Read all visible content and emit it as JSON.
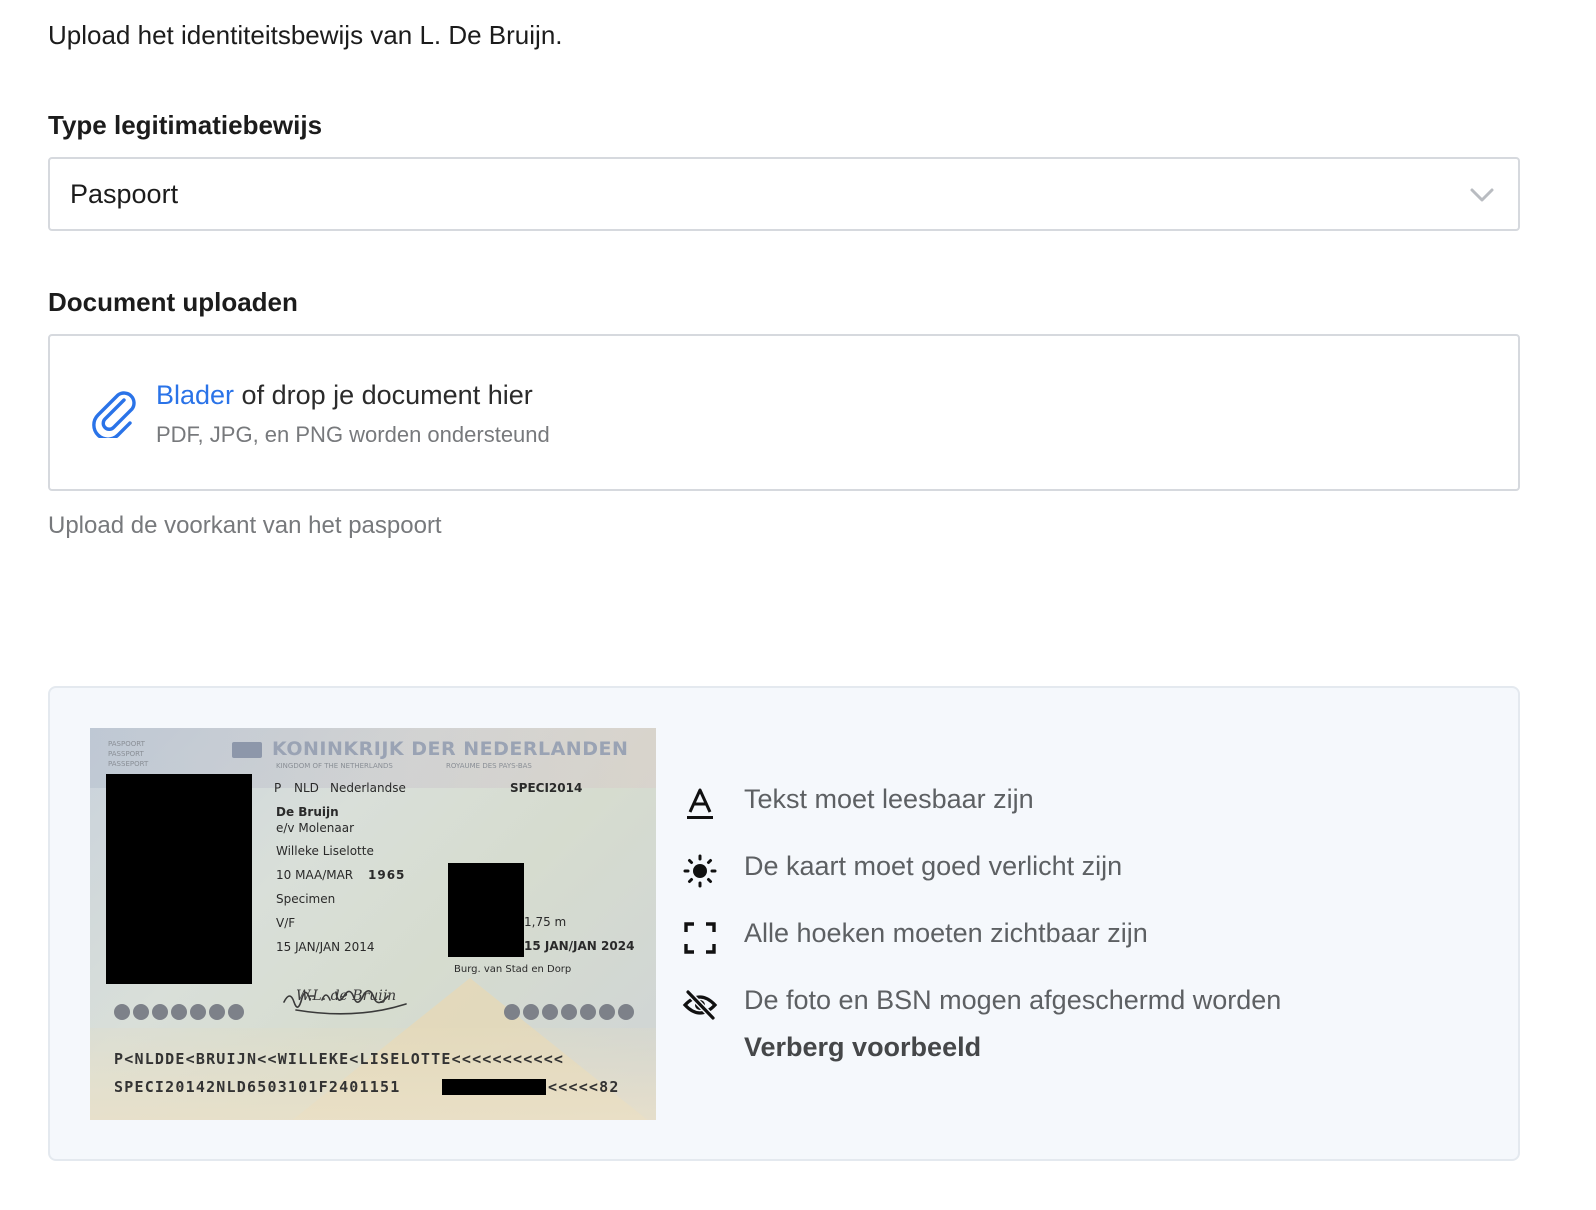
{
  "intro": "Upload het identiteitsbewijs van L. De Bruijn.",
  "id_type": {
    "label": "Type legitimatiebewijs",
    "selected": "Paspoort"
  },
  "upload": {
    "label": "Document uploaden",
    "browse": "Blader",
    "drop_text": " of drop je document hier",
    "formats": "PDF, JPG, en PNG worden ondersteund",
    "helper": "Upload de voorkant van het paspoort"
  },
  "preview": {
    "passport": {
      "doc_type": "PASPOORT",
      "doc_type_en": "PASSPORT",
      "doc_type_fr": "PASSEPORT",
      "country_title": "KONINKRIJK DER NEDERLANDEN",
      "kingdom_en": "KINGDOM OF THE NETHERLANDS",
      "kingdom_fr": "ROYAUME DES PAYS-BAS",
      "type_code": "P",
      "country_code": "NLD",
      "nationality": "Nederlandse",
      "doc_number": "SPECI2014",
      "surname": "De Bruijn",
      "spouse": "e/v Molenaar",
      "given_names": "Willeke Liselotte",
      "birth_date": "10 MAA/MAR",
      "birth_year": "1965",
      "birth_place": "Specimen",
      "sex": "V/F",
      "issue_date": "15 JAN/JAN 2014",
      "height": "1,75 m",
      "expiry_date": "15 JAN/JAN 2024",
      "authority": "Burg. van Stad en Dorp",
      "signature": "W.L. de Bruijn",
      "mrz1": "P<NLDDE<BRUIJN<<WILLEKE<LISELOTTE<<<<<<<<<<<",
      "mrz2_start": "SPECI20142NLD6503101F2401151",
      "mrz2_end": "<<<<<82"
    },
    "tips": [
      {
        "icon": "text-icon",
        "text": "Tekst moet leesbaar zijn"
      },
      {
        "icon": "brightness-icon",
        "text": "De kaart moet goed verlicht zijn"
      },
      {
        "icon": "corners-icon",
        "text": "Alle hoeken moeten zichtbaar zijn"
      },
      {
        "icon": "eye-off-icon",
        "text": "De foto en BSN mogen afgeschermd worden"
      }
    ],
    "hide_label": "Verberg voorbeeld"
  },
  "colors": {
    "accent": "#2a73e8",
    "muted": "#77797c",
    "panel_bg": "#f5f8fc"
  }
}
